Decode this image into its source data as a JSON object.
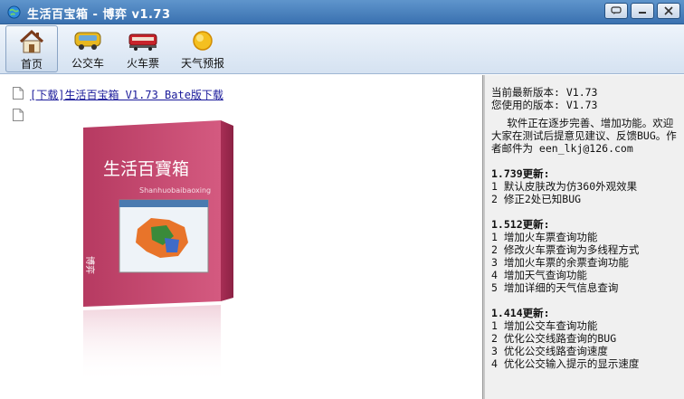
{
  "window": {
    "title": "生活百宝箱 - 博弈 v1.73"
  },
  "toolbar": {
    "items": [
      {
        "label": "首页",
        "icon": "house-icon"
      },
      {
        "label": "公交车",
        "icon": "bus-icon"
      },
      {
        "label": "火车票",
        "icon": "train-icon"
      },
      {
        "label": "天气预报",
        "icon": "sun-icon"
      }
    ]
  },
  "left": {
    "download_link": "[下载]生活百宝箱 V1.73 Bate版下载",
    "box_title": "生活百寶箱",
    "box_subtitle": "Shanhuobaibaoxing",
    "box_side": "博弈"
  },
  "right": {
    "latest_version": "当前最新版本: V1.73",
    "your_version": "您使用的版本: V1.73",
    "intro": "软件正在逐步完善、增加功能。欢迎大家在测试后提意见建议、反馈BUG。作者邮件为 een_lkj@126.com",
    "sections": [
      {
        "title": "1.739更新:",
        "items": [
          "1 默认皮肤改为仿360外观效果",
          "2 修正2处已知BUG"
        ]
      },
      {
        "title": "1.512更新:",
        "items": [
          "1 增加火车票查询功能",
          "2 修改火车票查询为多线程方式",
          "3 增加火车票的余票查询功能",
          "4 增加天气查询功能",
          "5 增加详细的天气信息查询"
        ]
      },
      {
        "title": "1.414更新:",
        "items": [
          "1 增加公交车查询功能",
          "2 优化公交线路查询的BUG",
          "3 优化公交线路查询速度",
          "4 优化公交输入提示的显示速度"
        ]
      }
    ]
  },
  "colors": {
    "titlebar": "#3a71b0",
    "box_pink": "#c0446b",
    "link": "#1a1a9a"
  }
}
